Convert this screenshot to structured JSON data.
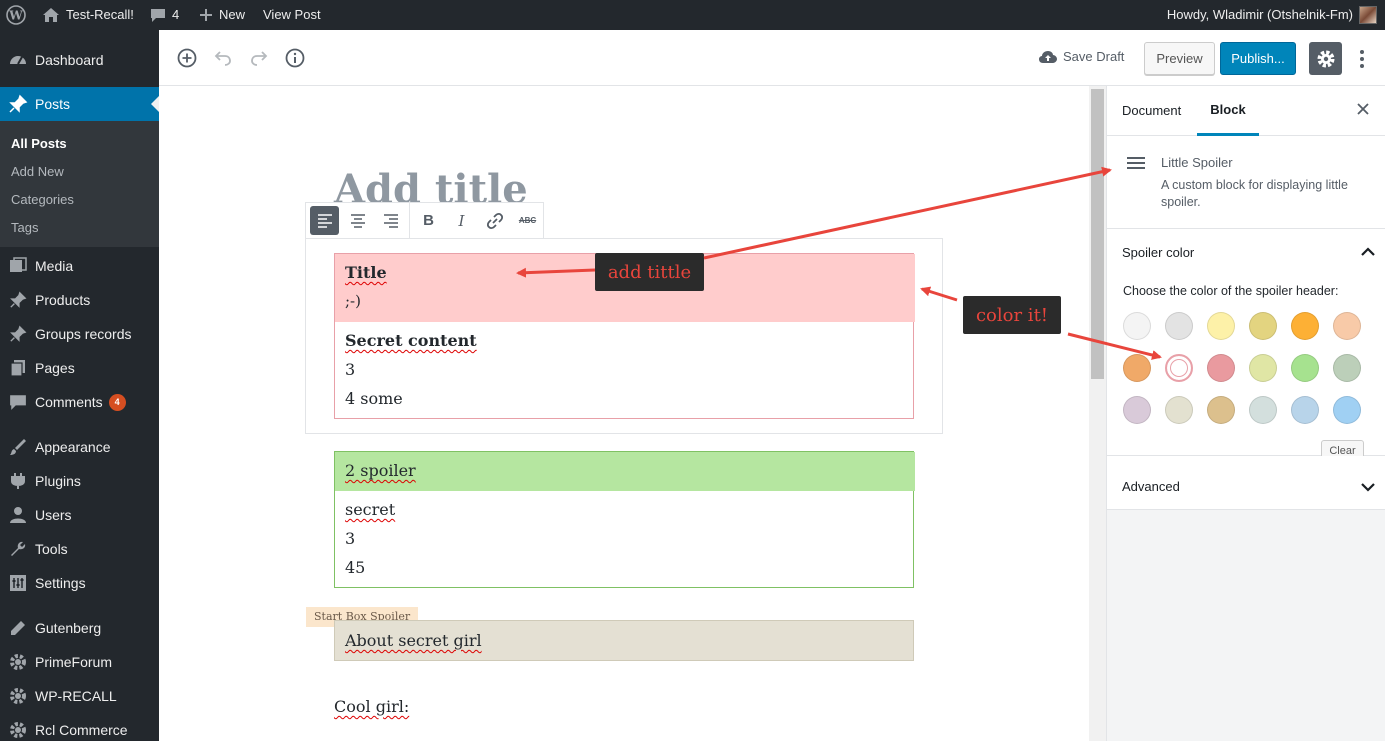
{
  "adminbar": {
    "site_name": "Test-Recall!",
    "comments_count": "4",
    "new_label": "New",
    "view_post_label": "View Post",
    "greeting": "Howdy, Wladimir (Otshelnik-Fm)"
  },
  "menu": {
    "dashboard": "Dashboard",
    "posts": "Posts",
    "posts_sub": [
      "All Posts",
      "Add New",
      "Categories",
      "Tags"
    ],
    "media": "Media",
    "products": "Products",
    "groups": "Groups records",
    "pages": "Pages",
    "comments": "Comments",
    "comments_badge": "4",
    "appearance": "Appearance",
    "plugins": "Plugins",
    "users": "Users",
    "tools": "Tools",
    "settings": "Settings",
    "gutenberg": "Gutenberg",
    "primeforum": "PrimeForum",
    "wprecall": "WP-RECALL",
    "rclcommerce": "Rcl Commerce"
  },
  "toolbar": {
    "save_draft": "Save Draft",
    "preview": "Preview",
    "publish": "Publish..."
  },
  "editor": {
    "title_placeholder": "Add title",
    "format_strike_label": "ABC",
    "block1": {
      "title": "Title",
      "title_sub": ";-)",
      "content_heading": "Secret content",
      "lines": [
        "3",
        "4 some"
      ],
      "header_color": "#ffcccc",
      "border_color": "#e8a0a8"
    },
    "block2": {
      "title": "2 spoiler",
      "lines": [
        "secret",
        "3",
        "45"
      ],
      "header_color": "#b5e6a0",
      "border_color": "#7fc163"
    },
    "block3_tag": "Start Box Spoiler",
    "block3_title": "About secret girl",
    "block3_color": "#e4e0d3",
    "paragraph": "Cool girl:"
  },
  "annotations": {
    "add_title": "add tittle",
    "color_it": "color it!"
  },
  "sidebar": {
    "tab_document": "Document",
    "tab_block": "Block",
    "block_name": "Little Spoiler",
    "block_desc": "A custom block for displaying little spoiler.",
    "spoiler_color_heading": "Spoiler color",
    "spoiler_color_desc": "Choose the color of the spoiler header:",
    "clear_label": "Clear",
    "advanced_heading": "Advanced",
    "swatches": [
      [
        "#f4f4f4",
        "#e3e3e3",
        "#fdf1a8",
        "#e3d480",
        "#fdb035",
        "#f8caa8"
      ],
      [
        "#f0a968",
        "#ffffff",
        "#e99a9f",
        "#e0e6a5",
        "#a6e28f",
        "#bccfb9"
      ],
      [
        "#d9cad9",
        "#e3e1d0",
        "#dcc08d",
        "#d3dfdd",
        "#b8d4ea",
        "#a0d0f3"
      ]
    ]
  }
}
